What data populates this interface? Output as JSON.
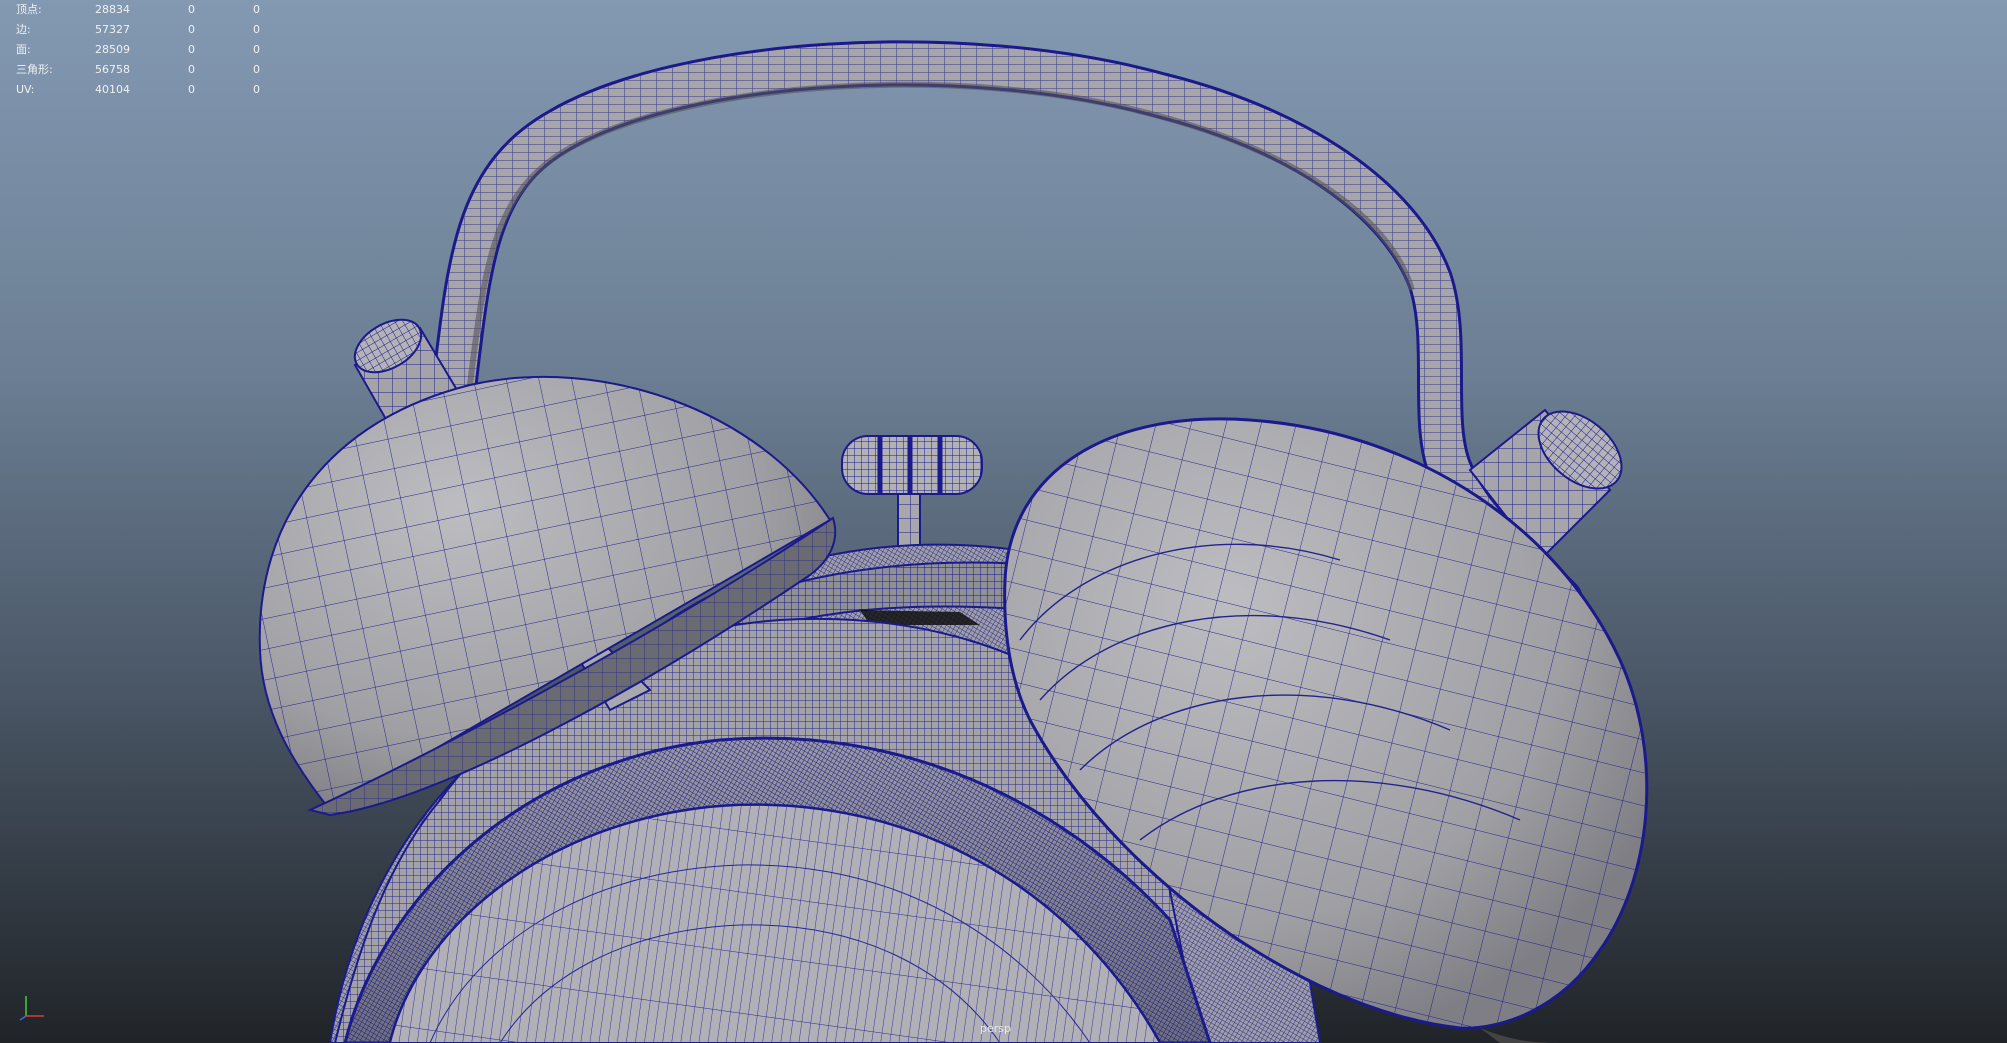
{
  "hud": {
    "rows": [
      {
        "label": "顶点:",
        "total": "28834",
        "selected": "0",
        "tris": "0"
      },
      {
        "label": "边:",
        "total": "57327",
        "selected": "0",
        "tris": "0"
      },
      {
        "label": "面:",
        "total": "28509",
        "selected": "0",
        "tris": "0"
      },
      {
        "label": "三角形:",
        "total": "56758",
        "selected": "0",
        "tris": "0"
      },
      {
        "label": "UV:",
        "total": "40104",
        "selected": "0",
        "tris": "0"
      }
    ]
  },
  "viewport": {
    "camera": "persp"
  },
  "colors": {
    "wire": "#1a1a8c",
    "surface": "#a8a8ac",
    "axis_y": "#3fcf3f",
    "axis_x": "#e03a3a",
    "axis_z": "#3a6ae0"
  },
  "icons": {
    "axis": "axis-gizmo-icon"
  }
}
